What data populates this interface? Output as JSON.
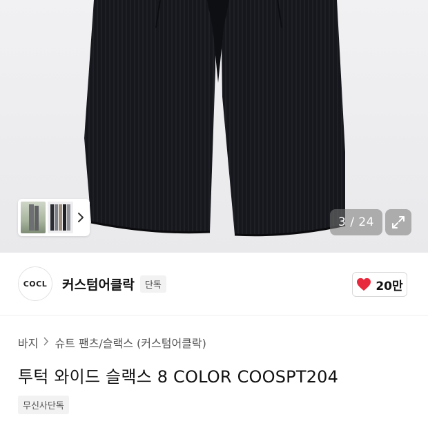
{
  "gallery": {
    "counter": "3 / 24",
    "thumbnail_next_icon": "chevron-right-icon",
    "expand_icon": "expand-arrows-icon"
  },
  "brand": {
    "logo_text": "COCL",
    "name": "커스텀어클락",
    "badge": "단독"
  },
  "like": {
    "icon": "heart-icon",
    "count": "20만",
    "color": "#e8283c"
  },
  "breadcrumb": {
    "items": [
      "바지",
      "슈트 팬츠/슬랙스 (커스텀어클락)"
    ],
    "separator_icon": "chevron-right-icon"
  },
  "product": {
    "title": "투턱 와이드 슬랙스 8 COLOR COOSPT204",
    "tag": "무신사단독"
  }
}
